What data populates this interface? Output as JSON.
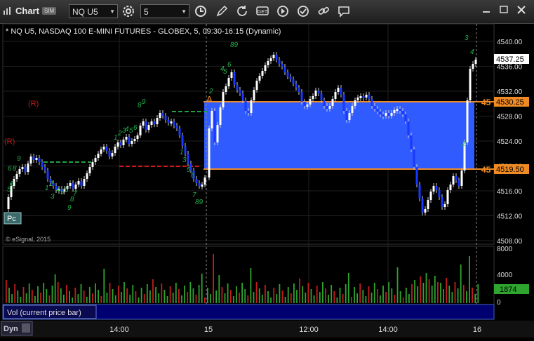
{
  "window": {
    "title": "Chart",
    "sim_badge": "SIM",
    "symbol": "NQ U5",
    "interval": "5"
  },
  "chart_header": "* NQ U5, NASDAQ 100 E-MINI FUTURES - GLOBEX, 5, 09:30-16:15 (Dynamic)",
  "watermark": "© eSignal, 2015",
  "volume_label": "Vol (current price bar)",
  "dyn_label": "Dyn",
  "pc_label": "Pc",
  "a_label": "A",
  "r_label": "(R)",
  "price_axis": {
    "ticks": [
      "4540.00",
      "4536.00",
      "4532.00",
      "4528.00",
      "4524.00",
      "4520.00",
      "4516.00",
      "4512.00",
      "4508.00"
    ],
    "current_price": "4537.25",
    "upper_level": "4530.25",
    "lower_level": "4519.50",
    "upper_level_left": "45",
    "lower_level_left": "45"
  },
  "volume_axis": {
    "ticks": [
      "8000",
      "4000",
      "0"
    ],
    "current": "1874"
  },
  "time_axis": [
    "14:00",
    "15",
    "12:00",
    "14:00",
    "16"
  ],
  "colors": {
    "up_bar": "#ffffff",
    "down_bar": "#1a38ff",
    "zone": "#2f5bff",
    "level_line": "#f08a24",
    "count": "#22b24c",
    "resistance": "#c21a1a",
    "vol_up": "#2ea52e",
    "vol_down": "#c41e1e"
  },
  "icons": [
    "chart-icon",
    "gear-icon",
    "clock-icon",
    "pencil-icon",
    "refresh-icon",
    "custom-icon",
    "play-icon",
    "check-icon",
    "link-icon",
    "note-icon",
    "minimize-icon",
    "maximize-icon",
    "close-icon"
  ]
}
